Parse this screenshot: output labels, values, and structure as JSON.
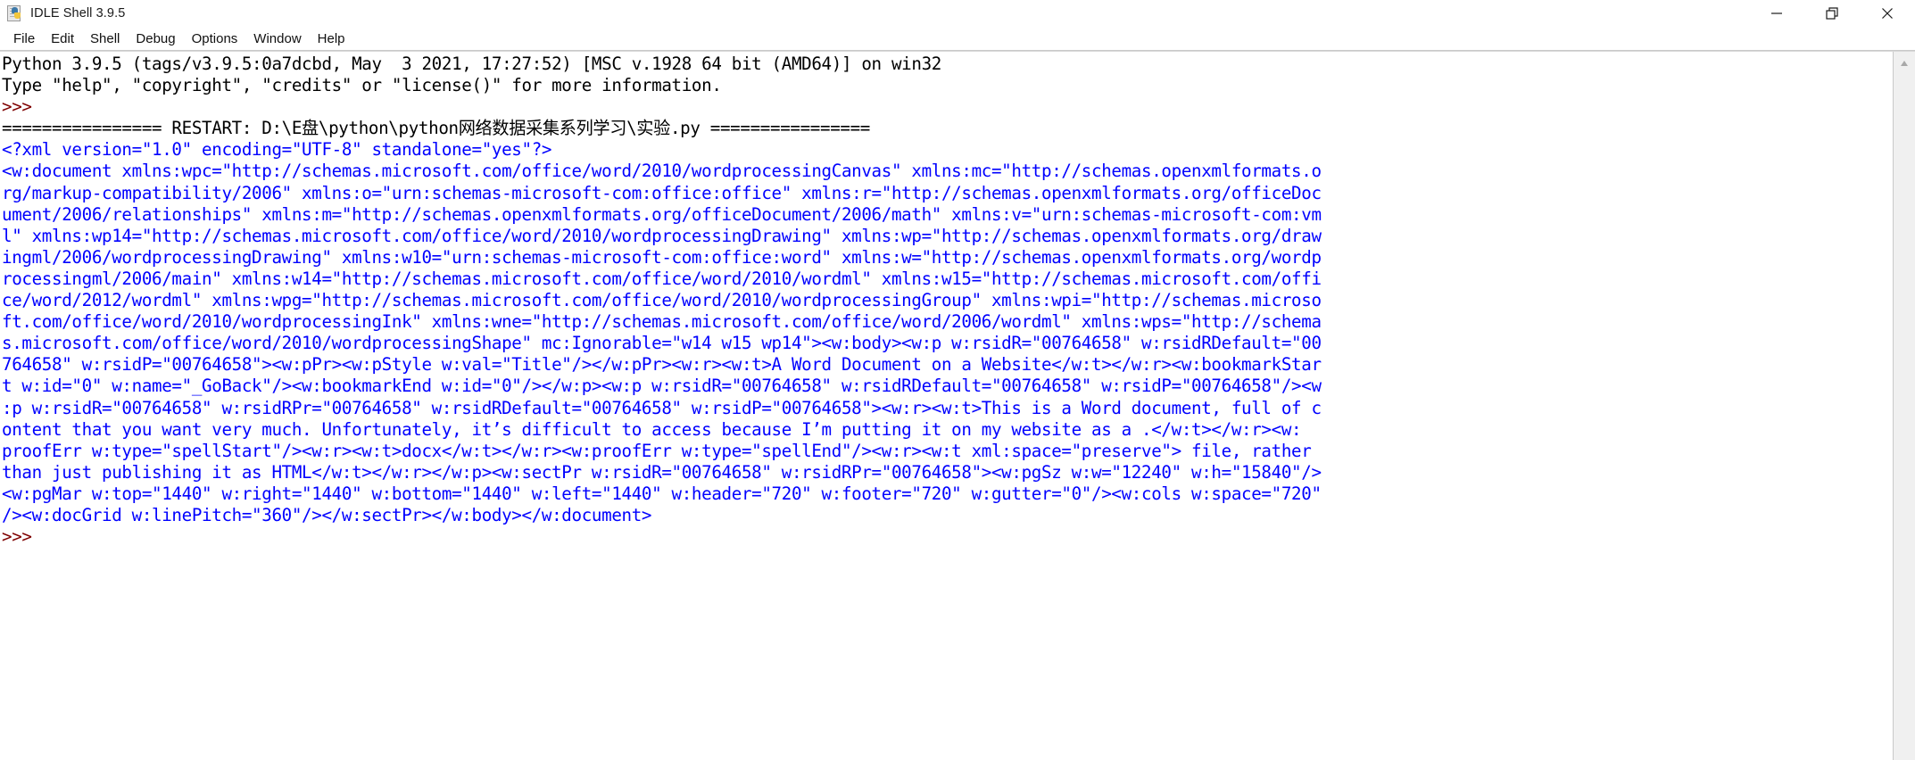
{
  "window": {
    "title": "IDLE Shell 3.9.5",
    "icon": "python-file-icon",
    "controls": {
      "minimize": "minimize-icon",
      "restore": "restore-icon",
      "close": "close-icon"
    }
  },
  "menubar": {
    "items": [
      {
        "label": "File"
      },
      {
        "label": "Edit"
      },
      {
        "label": "Shell"
      },
      {
        "label": "Debug"
      },
      {
        "label": "Options"
      },
      {
        "label": "Window"
      },
      {
        "label": "Help"
      }
    ]
  },
  "colors": {
    "stdout": "#0000ff",
    "prompt": "#7f0000",
    "text": "#000000",
    "background": "#ffffff",
    "scrollbar_track": "#f0f0f0"
  },
  "shell": {
    "lines": [
      {
        "color": "black",
        "text": "Python 3.9.5 (tags/v3.9.5:0a7dcbd, May  3 2021, 17:27:52) [MSC v.1928 64 bit (AMD64)] on win32"
      },
      {
        "color": "black",
        "text": "Type \"help\", \"copyright\", \"credits\" or \"license()\" for more information."
      },
      {
        "color": "prompt",
        "text": ">>> "
      },
      {
        "color": "black",
        "text": "================ RESTART: D:\\E盘\\python\\python网络数据采集系列学习\\实验.py ================"
      },
      {
        "color": "blue",
        "text": "<?xml version=\"1.0\" encoding=\"UTF-8\" standalone=\"yes\"?>"
      },
      {
        "color": "blue",
        "text": "<w:document xmlns:wpc=\"http://schemas.microsoft.com/office/word/2010/wordprocessingCanvas\" xmlns:mc=\"http://schemas.openxmlformats.o"
      },
      {
        "color": "blue",
        "text": "rg/markup-compatibility/2006\" xmlns:o=\"urn:schemas-microsoft-com:office:office\" xmlns:r=\"http://schemas.openxmlformats.org/officeDoc"
      },
      {
        "color": "blue",
        "text": "ument/2006/relationships\" xmlns:m=\"http://schemas.openxmlformats.org/officeDocument/2006/math\" xmlns:v=\"urn:schemas-microsoft-com:vm"
      },
      {
        "color": "blue",
        "text": "l\" xmlns:wp14=\"http://schemas.microsoft.com/office/word/2010/wordprocessingDrawing\" xmlns:wp=\"http://schemas.openxmlformats.org/draw"
      },
      {
        "color": "blue",
        "text": "ingml/2006/wordprocessingDrawing\" xmlns:w10=\"urn:schemas-microsoft-com:office:word\" xmlns:w=\"http://schemas.openxmlformats.org/wordp"
      },
      {
        "color": "blue",
        "text": "rocessingml/2006/main\" xmlns:w14=\"http://schemas.microsoft.com/office/word/2010/wordml\" xmlns:w15=\"http://schemas.microsoft.com/offi"
      },
      {
        "color": "blue",
        "text": "ce/word/2012/wordml\" xmlns:wpg=\"http://schemas.microsoft.com/office/word/2010/wordprocessingGroup\" xmlns:wpi=\"http://schemas.microso"
      },
      {
        "color": "blue",
        "text": "ft.com/office/word/2010/wordprocessingInk\" xmlns:wne=\"http://schemas.microsoft.com/office/word/2006/wordml\" xmlns:wps=\"http://schema"
      },
      {
        "color": "blue",
        "text": "s.microsoft.com/office/word/2010/wordprocessingShape\" mc:Ignorable=\"w14 w15 wp14\"><w:body><w:p w:rsidR=\"00764658\" w:rsidRDefault=\"00"
      },
      {
        "color": "blue",
        "text": "764658\" w:rsidP=\"00764658\"><w:pPr><w:pStyle w:val=\"Title\"/></w:pPr><w:r><w:t>A Word Document on a Website</w:t></w:r><w:bookmarkStar"
      },
      {
        "color": "blue",
        "text": "t w:id=\"0\" w:name=\"_GoBack\"/><w:bookmarkEnd w:id=\"0\"/></w:p><w:p w:rsidR=\"00764658\" w:rsidRDefault=\"00764658\" w:rsidP=\"00764658\"/><w"
      },
      {
        "color": "blue",
        "text": ":p w:rsidR=\"00764658\" w:rsidRPr=\"00764658\" w:rsidRDefault=\"00764658\" w:rsidP=\"00764658\"><w:r><w:t>This is a Word document, full of c"
      },
      {
        "color": "blue",
        "text": "ontent that you want very much. Unfortunately, it’s difficult to access because I’m putting it on my website as a .</w:t></w:r><w:"
      },
      {
        "color": "blue",
        "text": "proofErr w:type=\"spellStart\"/><w:r><w:t>docx</w:t></w:r><w:proofErr w:type=\"spellEnd\"/><w:r><w:t xml:space=\"preserve\"> file, rather"
      },
      {
        "color": "blue",
        "text": "than just publishing it as HTML</w:t></w:r></w:p><w:sectPr w:rsidR=\"00764658\" w:rsidRPr=\"00764658\"><w:pgSz w:w=\"12240\" w:h=\"15840\"/>"
      },
      {
        "color": "blue",
        "text": "<w:pgMar w:top=\"1440\" w:right=\"1440\" w:bottom=\"1440\" w:left=\"1440\" w:header=\"720\" w:footer=\"720\" w:gutter=\"0\"/><w:cols w:space=\"720\""
      },
      {
        "color": "blue",
        "text": "/><w:docGrid w:linePitch=\"360\"/></w:sectPr></w:body></w:document>"
      },
      {
        "color": "prompt",
        "text": ">>> "
      }
    ]
  }
}
